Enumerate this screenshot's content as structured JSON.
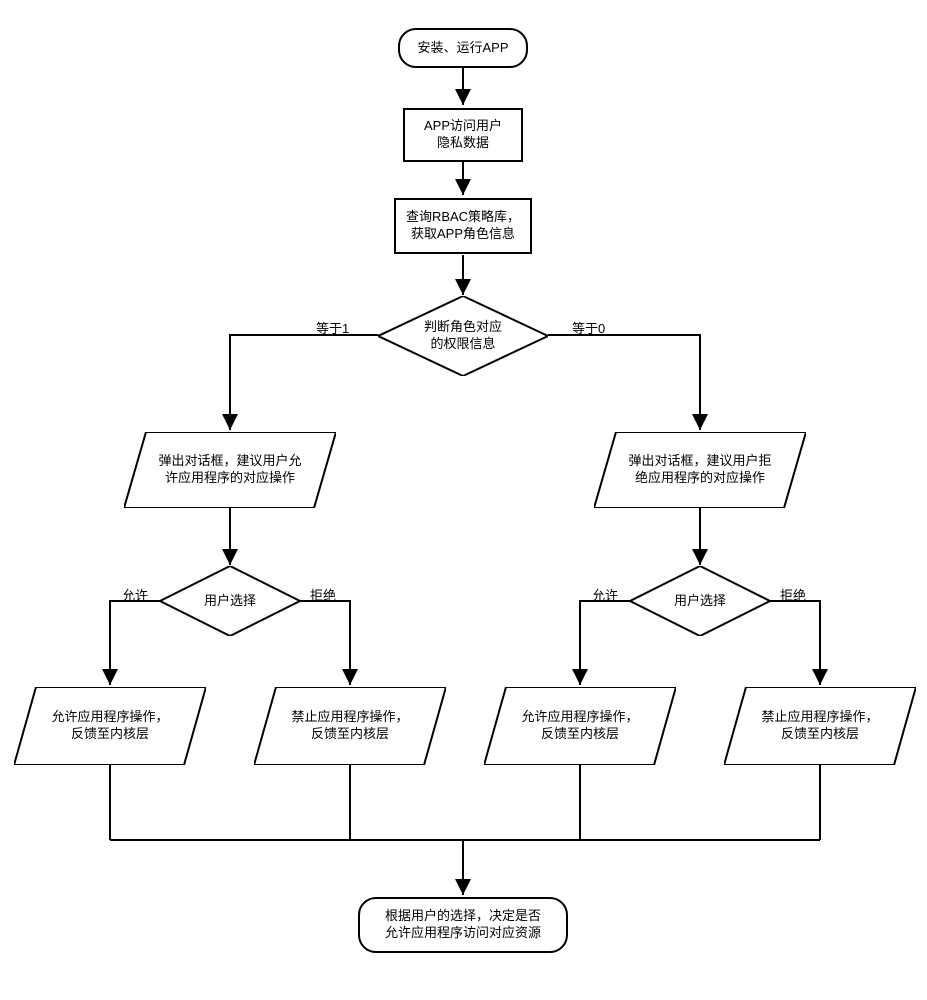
{
  "chart_data": {
    "type": "flowchart",
    "title": "",
    "nodes": [
      {
        "id": "start",
        "type": "terminator",
        "text": "安装、运行APP"
      },
      {
        "id": "access",
        "type": "process",
        "text": "APP访问用户\n隐私数据"
      },
      {
        "id": "query",
        "type": "process",
        "text": "查询RBAC策略库，\n获取APP角色信息"
      },
      {
        "id": "judge",
        "type": "decision",
        "text": "判断角色对应\n的权限信息"
      },
      {
        "id": "dlg_allow",
        "type": "io",
        "text": "弹出对话框，建议用户允\n许应用程序的对应操作"
      },
      {
        "id": "dlg_deny",
        "type": "io",
        "text": "弹出对话框，建议用户拒\n绝应用程序的对应操作"
      },
      {
        "id": "choice_left",
        "type": "decision",
        "text": "用户选择"
      },
      {
        "id": "choice_right",
        "type": "decision",
        "text": "用户选择"
      },
      {
        "id": "allow_left",
        "type": "io",
        "text": "允许应用程序操作，\n反馈至内核层"
      },
      {
        "id": "deny_left",
        "type": "io",
        "text": "禁止应用程序操作，\n反馈至内核层"
      },
      {
        "id": "allow_right",
        "type": "io",
        "text": "允许应用程序操作，\n反馈至内核层"
      },
      {
        "id": "deny_right",
        "type": "io",
        "text": "禁止应用程序操作，\n反馈至内核层"
      },
      {
        "id": "end",
        "type": "terminator",
        "text": "根据用户的选择，决定是否\n允许应用程序访问对应资源"
      }
    ],
    "edges": [
      {
        "from": "start",
        "to": "access"
      },
      {
        "from": "access",
        "to": "query"
      },
      {
        "from": "query",
        "to": "judge"
      },
      {
        "from": "judge",
        "to": "dlg_allow",
        "label": "等于1"
      },
      {
        "from": "judge",
        "to": "dlg_deny",
        "label": "等于0"
      },
      {
        "from": "dlg_allow",
        "to": "choice_left"
      },
      {
        "from": "dlg_deny",
        "to": "choice_right"
      },
      {
        "from": "choice_left",
        "to": "allow_left",
        "label": "允许"
      },
      {
        "from": "choice_left",
        "to": "deny_left",
        "label": "拒绝"
      },
      {
        "from": "choice_right",
        "to": "allow_right",
        "label": "允许"
      },
      {
        "from": "choice_right",
        "to": "deny_right",
        "label": "拒绝"
      },
      {
        "from": "allow_left",
        "to": "end"
      },
      {
        "from": "deny_left",
        "to": "end"
      },
      {
        "from": "allow_right",
        "to": "end"
      },
      {
        "from": "deny_right",
        "to": "end"
      }
    ]
  },
  "texts": {
    "start": "安装、运行APP",
    "access_l1": "APP访问用户",
    "access_l2": "隐私数据",
    "query_l1": "查询RBAC策略库，",
    "query_l2": "获取APP角色信息",
    "judge_l1": "判断角色对应",
    "judge_l2": "的权限信息",
    "dlg_allow_l1": "弹出对话框，建议用户允",
    "dlg_allow_l2": "许应用程序的对应操作",
    "dlg_deny_l1": "弹出对话框，建议用户拒",
    "dlg_deny_l2": "绝应用程序的对应操作",
    "choice": "用户选择",
    "allow_op_l1": "允许应用程序操作，",
    "allow_op_l2": "反馈至内核层",
    "deny_op_l1": "禁止应用程序操作，",
    "deny_op_l2": "反馈至内核层",
    "end_l1": "根据用户的选择，决定是否",
    "end_l2": "允许应用程序访问对应资源",
    "eq1": "等于1",
    "eq0": "等于0",
    "allow_lbl": "允许",
    "deny_lbl": "拒绝"
  }
}
